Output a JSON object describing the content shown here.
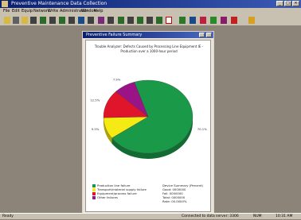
{
  "app": {
    "title": "Preventive Maintenance Data Collection",
    "window_buttons": [
      "_",
      "□",
      "×"
    ]
  },
  "menu": [
    "File",
    "Edit",
    "Equip",
    "Network",
    "Write",
    "Administration",
    "Window",
    "Help"
  ],
  "toolbar_icons": [
    "open-icon",
    "save-icon",
    "print-icon",
    "equip-icon",
    "network-icon",
    "log-icon",
    "chart-icon",
    "report-icon",
    "settings-icon",
    "help-icon"
  ],
  "chart_window": {
    "title": "Preventive Failure Summary",
    "report_title": "Trouble Analyzer: Defects Caused by Processing Line Equipment IE - Production over a 1000-hour period",
    "legend": [
      {
        "label": "Production line failure",
        "color": "#1a9a48"
      },
      {
        "label": "Transport/material supply failure",
        "color": "#f5ea14"
      },
      {
        "label": "Equipment/process failure",
        "color": "#e0142a"
      },
      {
        "label": "Other failures",
        "color": "#9a1488"
      }
    ],
    "summary": [
      "Device Summary (Percent)",
      "Good: 0000000",
      "Fail: 0000000",
      "Total: 0000000",
      "Rate: 00.0000%"
    ]
  },
  "chart_data": {
    "type": "pie",
    "title": "Trouble Analyzer: Defects Caused by Processing Line Equipment IE - Production over a 1000-hour period",
    "slices": [
      {
        "label": "Production line failure",
        "value": 70.1,
        "color": "#1a9a48"
      },
      {
        "label": "Transport/material supply failure",
        "value": 9.5,
        "color": "#f5ea14"
      },
      {
        "label": "Equipment/process failure",
        "value": 12.5,
        "color": "#e0142a"
      },
      {
        "label": "Other failures",
        "value": 7.9,
        "color": "#9a1488"
      }
    ],
    "data_labels": [
      "70.1%",
      "9.5%",
      "12.5%",
      "7.9%"
    ]
  },
  "status": {
    "left": "Ready",
    "right_1": "Connected to data server: 3306",
    "right_2": "NUM",
    "right_3": "10:31 AM"
  }
}
